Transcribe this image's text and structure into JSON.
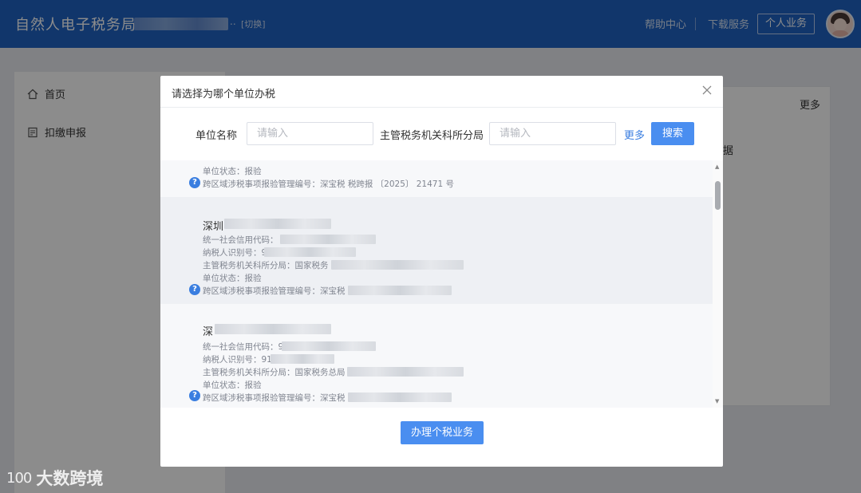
{
  "header": {
    "app_title": "自然人电子税务局",
    "switch_label": "[切换]",
    "dots": "..",
    "help_label": "帮助中心",
    "download_label": "下载服务",
    "personal_label": "个人业务"
  },
  "sidebar": {
    "items": [
      {
        "label": "首页",
        "icon": "home-icon"
      },
      {
        "label": "扣缴申报",
        "icon": "report-icon"
      }
    ]
  },
  "background": {
    "more_label": "更多",
    "data_partial": "据"
  },
  "modal": {
    "title": "请选择为哪个单位办税",
    "unit_label": "单位名称",
    "unit_placeholder": "请输入",
    "office_label": "主管税务机关科所分局",
    "office_placeholder": "请输入",
    "more_label": "更多",
    "search_label": "搜索",
    "handle_label": "办理个税业务",
    "list": [
      {
        "status": "单位状态：报验",
        "cross": "跨区域涉税事项报验管理编号：深宝税 税跨报 〔2025〕 21471 号"
      },
      {
        "name": "深圳",
        "credit": "统一社会信用代码：",
        "taxid": "纳税人识别号：914",
        "office": "主管税务机关科所分局：国家税务",
        "status": "单位状态：报验",
        "cross": "跨区域涉税事项报验管理编号：深宝税"
      },
      {
        "name": "深",
        "credit": "统一社会信用代码：9",
        "taxid": "纳税人识别号：91440",
        "office": "主管税务机关科所分局：国家税务总局",
        "status": "单位状态：报验",
        "cross": "跨区域涉税事项报验管理编号：深宝税"
      }
    ]
  },
  "watermark": {
    "logo": "100",
    "text": "大数跨境"
  },
  "colors": {
    "header_bg": "#1f63c4",
    "primary": "#4a8ef0",
    "link": "#3a7ee0"
  }
}
